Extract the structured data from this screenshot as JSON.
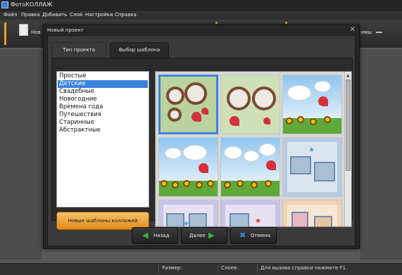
{
  "app": {
    "title": "ФотоКОЛЛАЖ"
  },
  "menu": [
    "Файл",
    "Правка",
    "Добавить",
    "Слой",
    "Настройки",
    "Справка"
  ],
  "toolbar": {
    "new_label": "Нов",
    "right_label": "ммы"
  },
  "status": {
    "size_label": "Размер:",
    "layers_label": "Слоев:",
    "help_text": "Для вызова справки нажмите F1."
  },
  "dialog": {
    "title": "Новый проект",
    "close_symbol": "×",
    "tabs": [
      "Тип проекта",
      "Выбор шаблона"
    ],
    "active_tab": "Выбор шаблона",
    "categories": [
      "Простые",
      "Детские",
      "Свадебные",
      "Новогодние",
      "Времена года",
      "Путешествия",
      "Старинные",
      "Абстрактные"
    ],
    "selected_category": "Детские",
    "new_templates_button": "Новые шаблоны коллажей",
    "buttons": {
      "back": "Назад",
      "next": "Далее",
      "cancel": "Отмена"
    },
    "icons": {
      "back": "arrow-left-icon",
      "next": "arrow-right-icon",
      "cancel": "x-icon"
    },
    "colors": {
      "accent": "#3c84db",
      "orange_button": "#f0a030",
      "back_arrow": "#3cb340",
      "cancel_x": "#3c84db"
    }
  }
}
